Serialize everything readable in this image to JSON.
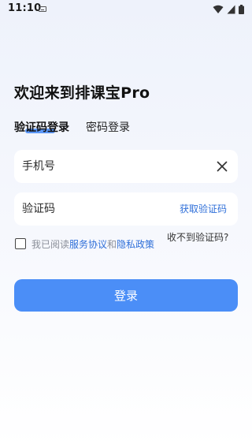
{
  "status_bar": {
    "time": "11:10",
    "icons": [
      "keyboard-icon",
      "wifi-icon",
      "signal-icon",
      "battery-icon"
    ]
  },
  "header": {
    "title": "欢迎来到排课宝Pro"
  },
  "tabs": [
    {
      "label": "验证码登录",
      "active": true
    },
    {
      "label": "密码登录",
      "active": false
    }
  ],
  "form": {
    "phone": {
      "placeholder": "手机号",
      "value": ""
    },
    "code": {
      "placeholder": "验证码",
      "value": ""
    },
    "get_code_label": "获取验证码",
    "clear_icon": "close-icon"
  },
  "agreement": {
    "checked": false,
    "prefix": "我已阅读",
    "service_label": "服务协议",
    "conjunction": "和",
    "privacy_label": "隐私政策",
    "no_code_label": "收不到验证码?"
  },
  "login_button_label": "登录",
  "colors": {
    "primary": "#4b8ef7",
    "link": "#2f6fd9",
    "muted_text": "#8b8f99",
    "background_top": "#eef2fb"
  }
}
